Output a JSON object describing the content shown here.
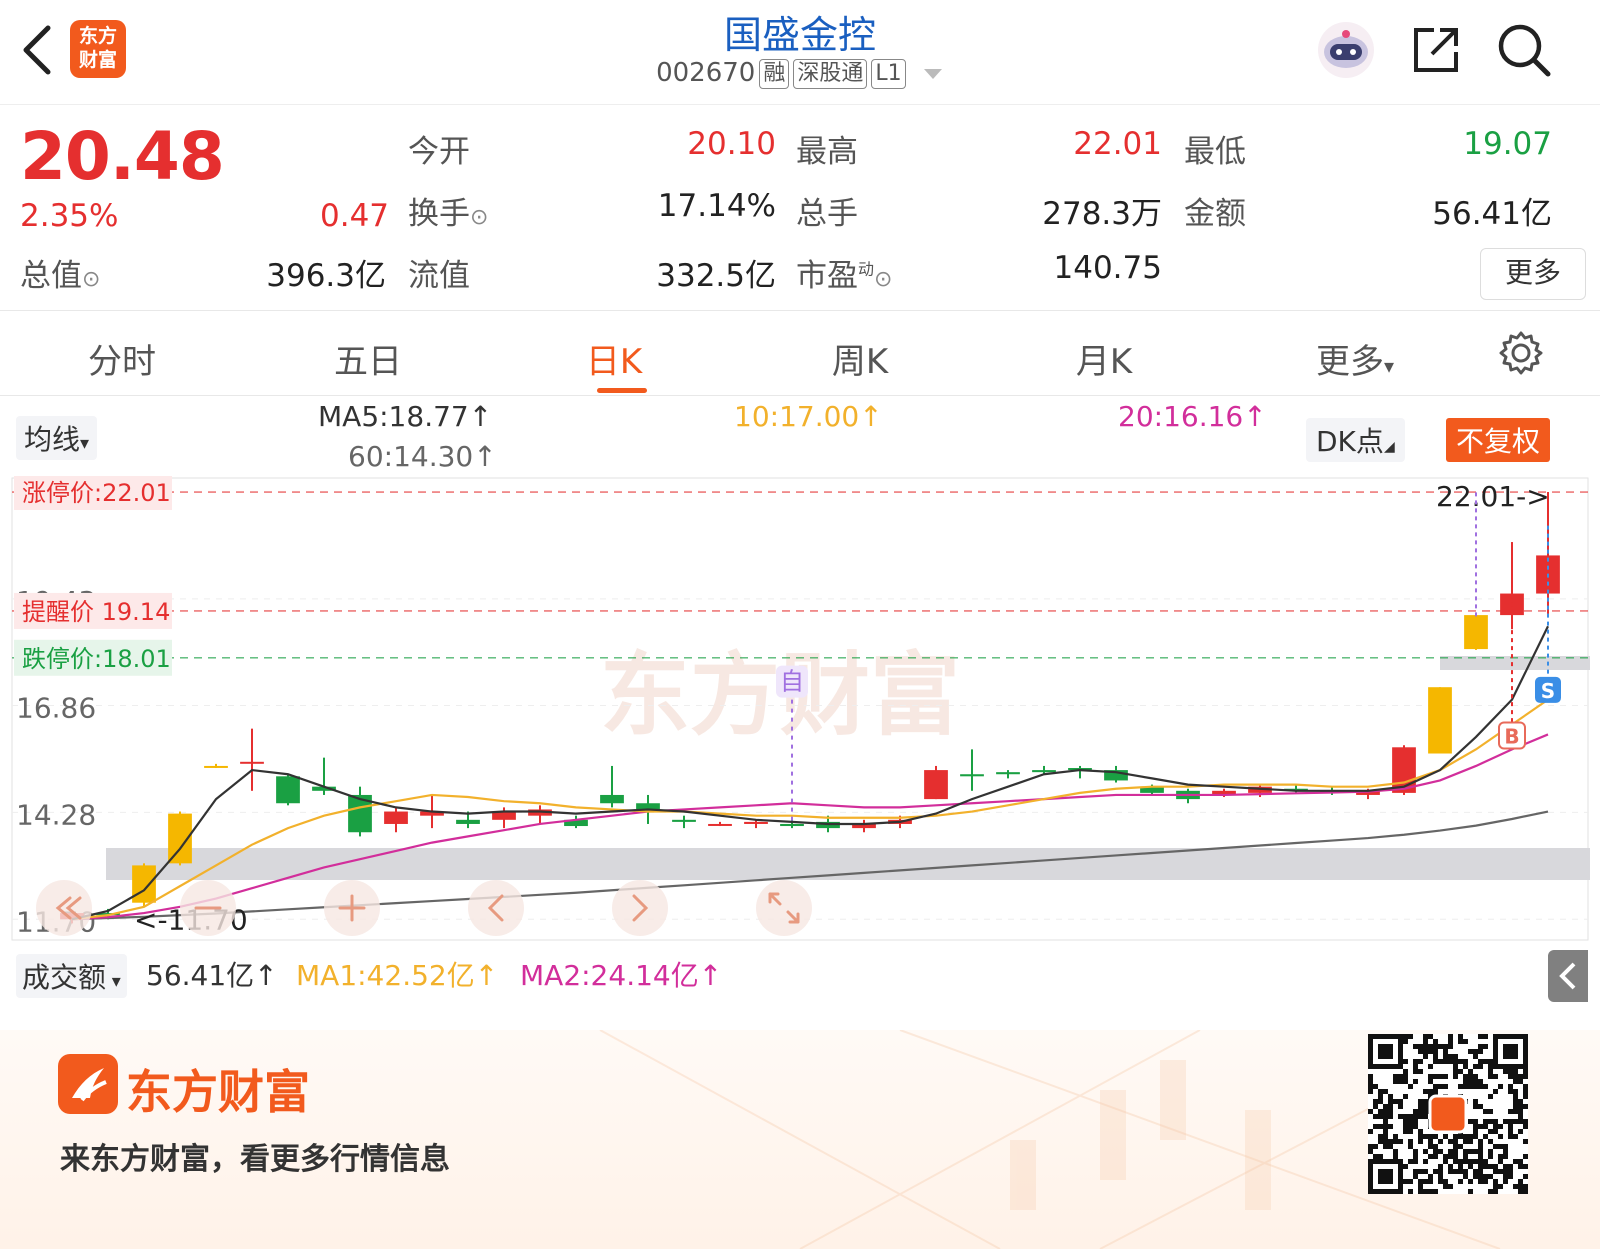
{
  "header": {
    "logo_text": "东方财富",
    "logo_line1": "东方",
    "logo_line2": "财富",
    "title": "国盛金控",
    "code": "002670",
    "tags": [
      "融",
      "深股通",
      "L1"
    ]
  },
  "quote": {
    "price": "20.48",
    "change_pct": "2.35%",
    "change": "0.47",
    "fields": {
      "open_label": "今开",
      "open": "20.10",
      "high_label": "最高",
      "high": "22.01",
      "low_label": "最低",
      "low": "19.07",
      "turnover_label": "换手",
      "turnover": "17.14%",
      "volume_label": "总手",
      "volume": "278.3万",
      "amount_label": "金额",
      "amount": "56.41亿",
      "mcap_label": "总值",
      "mcap": "396.3亿",
      "float_label": "流值",
      "float": "332.5亿",
      "pe_label": "市盈",
      "pe_sup": "动",
      "pe": "140.75"
    },
    "more_label": "更多"
  },
  "tabs": [
    "分时",
    "五日",
    "日K",
    "周K",
    "月K",
    "更多"
  ],
  "active_tab": 2,
  "indicators": {
    "selector": "均线",
    "ma5": "MA5:18.77↑",
    "ma10": "10:17.00↑",
    "ma20": "20:16.16↑",
    "ma60": "60:14.30↑",
    "dk": "DK点",
    "adjust": "不复权"
  },
  "chart_data": {
    "type": "candlestick",
    "y_labels": [
      "19.43",
      "16.86",
      "14.28",
      "11.70"
    ],
    "ylim": [
      11.2,
      22.3
    ],
    "limit_up": "涨停价:22.01",
    "limit_up_value": 22.01,
    "alert": "提醒价 19.14",
    "alert_value": 19.14,
    "limit_down": "跌停价:18.01",
    "limit_down_value": 18.01,
    "high_marker": "22.01->",
    "low_marker": "<-11.70",
    "watermark": "东方财富",
    "self_marker": "自",
    "buy_marker": "B",
    "sell_marker": "S",
    "candles": [
      [
        11.7,
        11.85,
        11.6,
        11.9
      ],
      [
        11.85,
        11.8,
        11.7,
        11.95
      ],
      [
        12.1,
        13.0,
        12.0,
        13.05
      ],
      [
        13.05,
        14.25,
        13.0,
        14.3
      ],
      [
        15.4,
        15.4,
        15.35,
        15.45
      ],
      [
        15.5,
        15.5,
        14.8,
        16.3
      ],
      [
        15.15,
        14.5,
        14.45,
        15.2
      ],
      [
        14.9,
        14.8,
        14.7,
        15.6
      ],
      [
        14.7,
        13.8,
        13.7,
        14.9
      ],
      [
        14.0,
        14.3,
        13.8,
        14.4
      ],
      [
        14.2,
        14.3,
        13.9,
        14.7
      ],
      [
        14.1,
        14.0,
        13.9,
        14.3
      ],
      [
        14.1,
        14.3,
        13.9,
        14.4
      ],
      [
        14.2,
        14.35,
        14.0,
        14.45
      ],
      [
        14.1,
        13.95,
        13.9,
        14.2
      ],
      [
        14.7,
        14.5,
        14.4,
        15.4
      ],
      [
        14.5,
        14.3,
        14.0,
        14.7
      ],
      [
        14.1,
        14.05,
        13.9,
        14.2
      ],
      [
        14.0,
        14.0,
        13.95,
        14.05
      ],
      [
        14.0,
        14.05,
        13.9,
        14.1
      ],
      [
        14.0,
        13.95,
        13.9,
        14.1
      ],
      [
        14.05,
        13.9,
        13.8,
        14.2
      ],
      [
        13.9,
        14.0,
        13.8,
        14.1
      ],
      [
        14.0,
        14.1,
        13.9,
        14.2
      ],
      [
        14.6,
        15.3,
        14.6,
        15.4
      ],
      [
        15.2,
        15.15,
        14.8,
        15.8
      ],
      [
        15.25,
        15.2,
        15.1,
        15.3
      ],
      [
        15.3,
        15.25,
        15.2,
        15.4
      ],
      [
        15.35,
        15.3,
        15.1,
        15.4
      ],
      [
        15.3,
        15.05,
        15.0,
        15.4
      ],
      [
        14.9,
        14.75,
        14.7,
        14.95
      ],
      [
        14.8,
        14.6,
        14.5,
        14.85
      ],
      [
        14.7,
        14.8,
        14.65,
        14.85
      ],
      [
        14.75,
        14.9,
        14.65,
        14.95
      ],
      [
        14.85,
        14.8,
        14.75,
        14.95
      ],
      [
        14.8,
        14.75,
        14.7,
        14.9
      ],
      [
        14.7,
        14.8,
        14.6,
        14.85
      ],
      [
        14.75,
        15.85,
        14.7,
        15.9
      ],
      [
        15.7,
        17.3,
        15.7,
        17.3
      ],
      [
        18.22,
        19.04,
        18.2,
        19.04
      ],
      [
        19.04,
        19.56,
        18.7,
        20.8
      ],
      [
        19.56,
        20.48,
        19.07,
        22.01
      ]
    ],
    "ma5": [
      11.7,
      11.9,
      12.4,
      13.4,
      14.6,
      15.3,
      15.2,
      14.9,
      14.6,
      14.4,
      14.3,
      14.25,
      14.3,
      14.3,
      14.25,
      14.3,
      14.35,
      14.3,
      14.2,
      14.1,
      14.05,
      14.0,
      14.0,
      14.05,
      14.25,
      14.6,
      14.9,
      15.2,
      15.3,
      15.25,
      15.1,
      14.95,
      14.9,
      14.85,
      14.8,
      14.8,
      14.8,
      14.9,
      15.3,
      16.1,
      17.0,
      18.77
    ],
    "ma10": [
      11.7,
      11.8,
      12.0,
      12.5,
      13.0,
      13.5,
      13.9,
      14.2,
      14.4,
      14.55,
      14.7,
      14.65,
      14.55,
      14.5,
      14.4,
      14.35,
      14.3,
      14.3,
      14.25,
      14.2,
      14.2,
      14.15,
      14.15,
      14.15,
      14.2,
      14.3,
      14.45,
      14.6,
      14.75,
      14.85,
      14.9,
      14.9,
      14.95,
      14.95,
      14.95,
      14.9,
      14.9,
      15.0,
      15.3,
      15.8,
      16.4,
      17.0
    ],
    "ma20": [
      11.7,
      11.75,
      11.85,
      12.0,
      12.2,
      12.45,
      12.7,
      12.95,
      13.15,
      13.35,
      13.55,
      13.7,
      13.85,
      14.0,
      14.1,
      14.2,
      14.3,
      14.35,
      14.4,
      14.45,
      14.5,
      14.45,
      14.4,
      14.4,
      14.45,
      14.5,
      14.55,
      14.6,
      14.65,
      14.7,
      14.7,
      14.7,
      14.7,
      14.72,
      14.74,
      14.76,
      14.78,
      14.85,
      15.05,
      15.4,
      15.8,
      16.16
    ],
    "ma60": [
      11.7,
      11.73,
      11.76,
      11.8,
      11.84,
      11.89,
      11.94,
      11.99,
      12.04,
      12.09,
      12.14,
      12.19,
      12.24,
      12.29,
      12.34,
      12.4,
      12.46,
      12.52,
      12.58,
      12.64,
      12.7,
      12.76,
      12.82,
      12.88,
      12.94,
      13.0,
      13.06,
      13.12,
      13.18,
      13.24,
      13.3,
      13.36,
      13.42,
      13.48,
      13.54,
      13.6,
      13.66,
      13.74,
      13.84,
      13.96,
      14.12,
      14.3
    ]
  },
  "volume_bar": {
    "selector": "成交额",
    "value": "56.41亿↑",
    "ma1": "MA1:42.52亿↑",
    "ma2": "MA2:24.14亿↑"
  },
  "colors": {
    "up": "#e52f2f",
    "down": "#1aa043",
    "flat": "#f5b700",
    "ma5": "#333333",
    "ma10": "#f2b12c",
    "ma20": "#d22e9b",
    "ma60": "#666666",
    "accent": "#f25a1d"
  },
  "footer": {
    "brand": "东方财富",
    "slogan": "来东方财富，看更多行情信息"
  }
}
